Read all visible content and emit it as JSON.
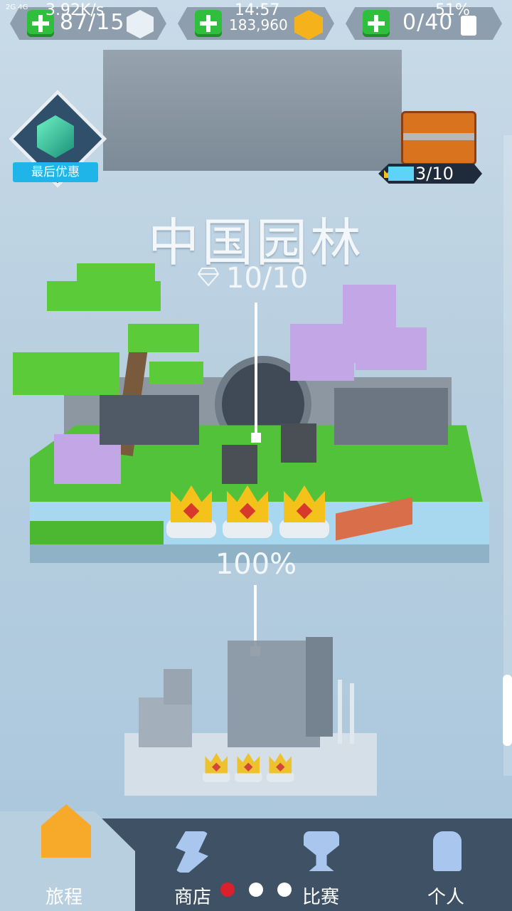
{
  "status_bar": {
    "network": "2G 4G",
    "speed": "3.92K/s",
    "time": "14:57",
    "battery": "51%"
  },
  "resources": {
    "energy": "87/15",
    "coins": "183,960",
    "tickets": "0/40"
  },
  "offer": {
    "label": "最后优惠"
  },
  "chest": {
    "progress_text": "3/10",
    "progress_fraction": 0.3
  },
  "level": {
    "title": "中国园林",
    "gems": "10/10",
    "completion": "100%"
  },
  "nav": {
    "items": [
      {
        "label": "旅程",
        "icon": "house-icon",
        "selected": true
      },
      {
        "label": "商店",
        "icon": "shop-icon",
        "selected": false
      },
      {
        "label": "比赛",
        "icon": "trophy-icon",
        "selected": false
      },
      {
        "label": "个人",
        "icon": "person-icon",
        "selected": false
      }
    ],
    "page_dots": [
      "red",
      "white",
      "white"
    ]
  },
  "colors": {
    "accent_green": "#2fbf3c",
    "offer_blue": "#1fb5e8",
    "crown_gold": "#f4c21a",
    "nav_bg": "#3f5265"
  }
}
